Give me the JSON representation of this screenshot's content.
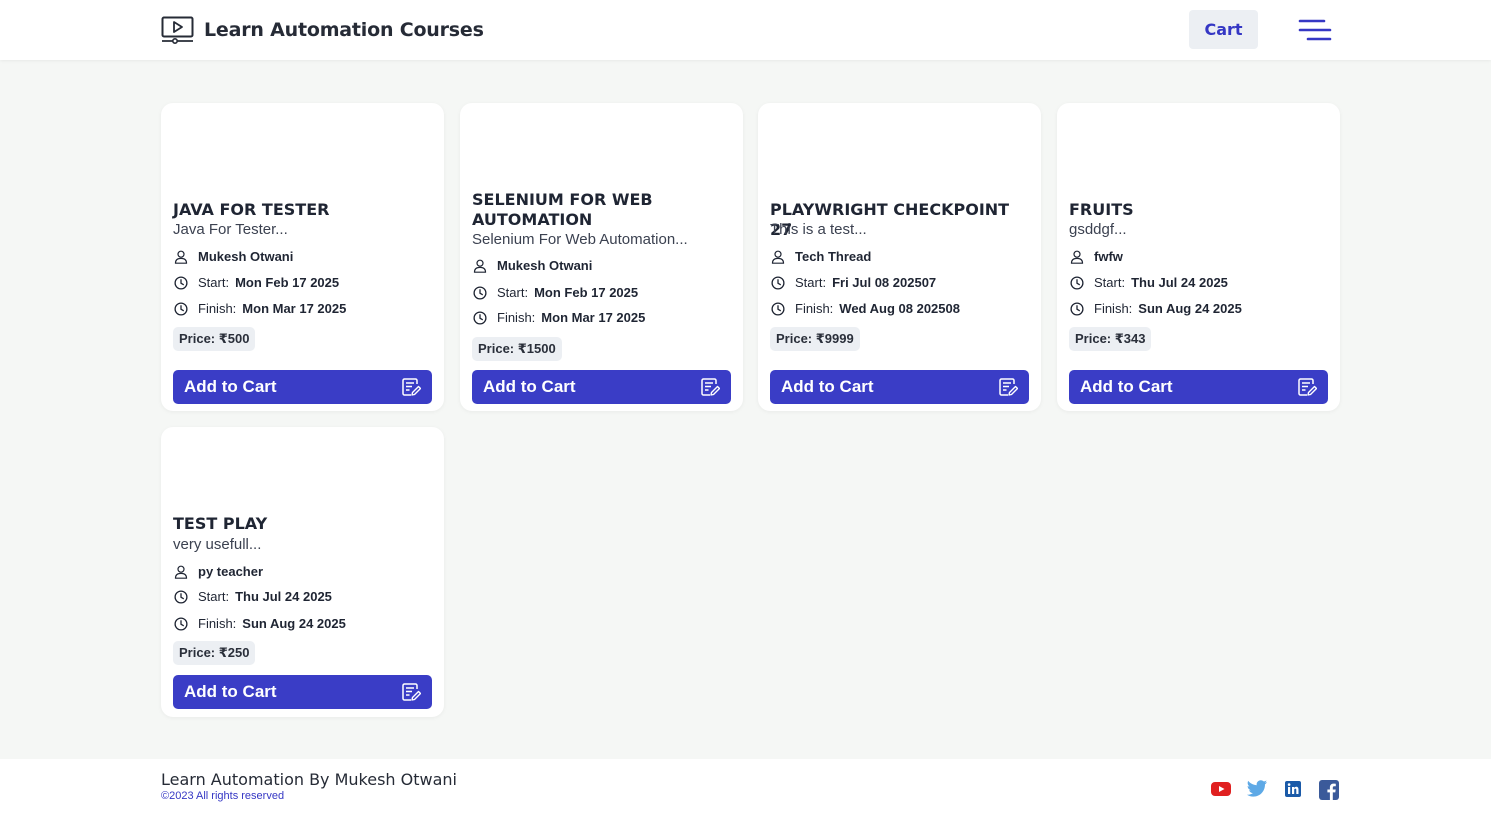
{
  "header": {
    "title": "Learn Automation Courses",
    "logo_icon": "video-player-icon",
    "cart_label": "Cart",
    "menu_icon": "hamburger-menu-icon"
  },
  "colors": {
    "accent": "#3a3dc6",
    "background": "#f5f7f5",
    "badge_bg": "#eceff3"
  },
  "labels": {
    "start": "Start:",
    "finish": "Finish:",
    "add_to_cart": "Add to Cart"
  },
  "courses": [
    {
      "title": "JAVA FOR TESTER",
      "description": "Java For Tester...",
      "instructor": "Mukesh Otwani",
      "start": "Mon Feb 17 2025",
      "finish": "Mon Mar 17 2025",
      "price": "Price: ₹500"
    },
    {
      "title": "SELENIUM FOR WEB AUTOMATION",
      "description": "Selenium For Web Automation...",
      "instructor": "Mukesh Otwani",
      "start": "Mon Feb 17 2025",
      "finish": "Mon Mar 17 2025",
      "price": "Price: ₹1500"
    },
    {
      "title": "PLAYWRIGHT CHECKPOINT 27",
      "description": "This is a test...",
      "instructor": "Tech Thread",
      "start": "Fri Jul 08 202507",
      "finish": "Wed Aug 08 202508",
      "price": "Price: ₹9999"
    },
    {
      "title": "FRUITS",
      "description": "gsddgf...",
      "instructor": "fwfw",
      "start": "Thu Jul 24 2025",
      "finish": "Sun Aug 24 2025",
      "price": "Price: ₹343"
    },
    {
      "title": "TEST PLAY",
      "description": "very usefull...",
      "instructor": "py teacher",
      "start": "Thu Jul 24 2025",
      "finish": "Sun Aug 24 2025",
      "price": "Price: ₹250"
    }
  ],
  "footer": {
    "title": "Learn Automation By Mukesh Otwani",
    "copyright": "©2023 All rights reserved",
    "social_icons": [
      "youtube-icon",
      "twitter-icon",
      "linkedin-icon",
      "facebook-icon"
    ]
  }
}
